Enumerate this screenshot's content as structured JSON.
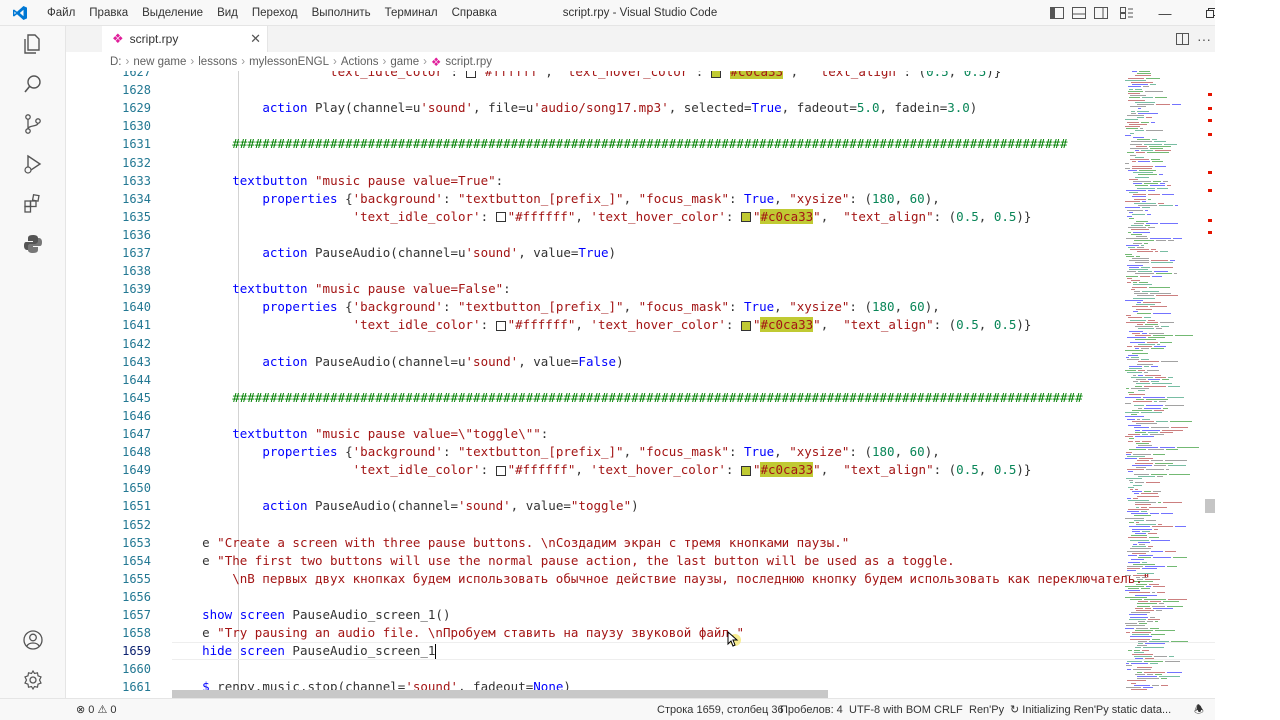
{
  "titlebar": {
    "menu": [
      "Файл",
      "Правка",
      "Выделение",
      "Вид",
      "Переход",
      "Выполнить",
      "Терминал",
      "Справка"
    ],
    "title": "script.rpy - Visual Studio Code"
  },
  "tab": {
    "label": "script.rpy"
  },
  "breadcrumb": [
    "D:",
    "new game",
    "lessons",
    "mylessonENGL",
    "Actions",
    "game",
    "script.rpy"
  ],
  "editor": {
    "current_line": "1659",
    "lines": [
      {
        "n": "1627",
        "text": "                    'text_idle_color': □\"#ffffff\", 'text_hover_color': ■\"#c0ca33\",  \"text_align\": (0.5, 0.5)}"
      },
      {
        "n": "1628",
        "text": ""
      },
      {
        "n": "1629",
        "text": "            action Play(channel=u'sound', file=u'audio/song17.mp3', selected=True, fadeout=5.0, fadein=3.0)"
      },
      {
        "n": "1630",
        "text": ""
      },
      {
        "n": "1631",
        "text": "        ###############################################################################################################"
      },
      {
        "n": "1632",
        "text": ""
      },
      {
        "n": "1633",
        "text": "        textbutton \"music pause value=True\":"
      },
      {
        "n": "1634",
        "text": "            properties {'background': \"textbutton_[prefix_]\", \"focus_mask\": True, \"xysize\": (180, 60),"
      },
      {
        "n": "1635",
        "text": "                        'text_idle_color': □\"#ffffff\", 'text_hover_color': ■\"#c0ca33\",  \"text_align\": (0.5, 0.5)}"
      },
      {
        "n": "1636",
        "text": ""
      },
      {
        "n": "1637",
        "text": "            action PauseAudio(channel=u'sound', value=True)"
      },
      {
        "n": "1638",
        "text": ""
      },
      {
        "n": "1639",
        "text": "        textbutton \"music pause value=False\":"
      },
      {
        "n": "1640",
        "text": "            properties {'background': \"textbutton_[prefix_]\", \"focus_mask\": True, \"xysize\": (180, 60),"
      },
      {
        "n": "1641",
        "text": "                        'text_idle_color': □\"#ffffff\", 'text_hover_color': ■\"#c0ca33\",  \"text_align\": (0.5, 0.5)}"
      },
      {
        "n": "1642",
        "text": ""
      },
      {
        "n": "1643",
        "text": "            action PauseAudio(channel=u'sound', value=False)"
      },
      {
        "n": "1644",
        "text": ""
      },
      {
        "n": "1645",
        "text": "        #################################################################################################################"
      },
      {
        "n": "1646",
        "text": ""
      },
      {
        "n": "1647",
        "text": "        textbutton \"music pause value=\\\"toggle\\\"\":"
      },
      {
        "n": "1648",
        "text": "            properties {'background': \"textbutton_[prefix_]\", \"focus_mask\": True, \"xysize\": (180, 60),"
      },
      {
        "n": "1649",
        "text": "                        'text_idle_color': □\"#ffffff\", 'text_hover_color': ■\"#c0ca33\",  \"text_align\": (0.5, 0.5)}"
      },
      {
        "n": "1650",
        "text": ""
      },
      {
        "n": "1651",
        "text": "            action PauseAudio(channel='sound', value=\"toggle\")"
      },
      {
        "n": "1652",
        "text": ""
      },
      {
        "n": "1653",
        "text": "    e \"Create a screen with three pause buttons. \\nСоздадим экран с тремя кнопками паузы.\""
      },
      {
        "n": "1654",
        "text": "    e \"The first two buttons will use the normal pause action, the last button will be used as a toggle."
      },
      {
        "n": "1655",
        "text": "        \\nВ первых двух кнопках будем использовать обычное действие паузы, последнюю кнопку будем использовать как переключатель.\""
      },
      {
        "n": "1656",
        "text": ""
      },
      {
        "n": "1657",
        "text": "    show screen PauseAudio_screen_1()"
      },
      {
        "n": "1658",
        "text": "    e \"Try pausing an audio file. \\nПробуем ставить на паузу звуковой файл.\""
      },
      {
        "n": "1659",
        "text": "    hide screen PauseAudio_screen_1"
      },
      {
        "n": "1660",
        "text": ""
      },
      {
        "n": "1661",
        "text": "    $ renpy.music.stop(channel='sound', fadeout=None)"
      }
    ]
  },
  "statusbar": {
    "errors": "0",
    "warnings": "0",
    "position": "Строка 1659, столбец 36",
    "spaces": "Пробелов: 4",
    "encoding": "UTF-8 with BOM",
    "eol": "CRLF",
    "language": "Ren'Py",
    "task": "Initializing Ren'Py static data..."
  },
  "colors": {
    "accent": "#007acc",
    "keyword": "#0000ff",
    "string": "#a31515",
    "comment": "#008000",
    "number": "#098658",
    "swatch_highlight": "#c0ca33"
  }
}
